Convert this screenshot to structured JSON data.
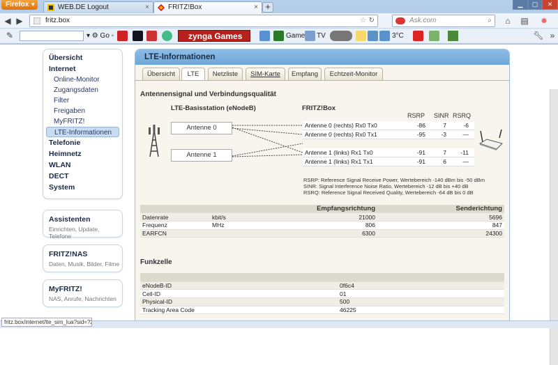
{
  "browser": {
    "menu_button": "Firefox",
    "tabs": [
      {
        "title": "WEB.DE Logout"
      },
      {
        "title": "FRITZ!Box"
      }
    ],
    "url": "fritz.box",
    "search_placeholder": "Ask.com",
    "toolbar": {
      "go_label": "Go",
      "zynga_label": "zynga Games",
      "games_label": "Games",
      "tv_label": "TV",
      "temp_label": "3°C"
    },
    "status_url": "fritz.box/internet/lte_sim_lua?sid=?2062dd466e8f60"
  },
  "sidebar": {
    "menu": [
      {
        "label": "Übersicht",
        "level": "main"
      },
      {
        "label": "Internet",
        "level": "main"
      },
      {
        "label": "Online-Monitor",
        "level": "sub"
      },
      {
        "label": "Zugangsdaten",
        "level": "sub"
      },
      {
        "label": "Filter",
        "level": "sub"
      },
      {
        "label": "Freigaben",
        "level": "sub"
      },
      {
        "label": "MyFRITZ!",
        "level": "sub"
      },
      {
        "label": "LTE-Informationen",
        "level": "sub",
        "selected": true
      },
      {
        "label": "Telefonie",
        "level": "main"
      },
      {
        "label": "Heimnetz",
        "level": "main"
      },
      {
        "label": "WLAN",
        "level": "main"
      },
      {
        "label": "DECT",
        "level": "main"
      },
      {
        "label": "System",
        "level": "main"
      }
    ],
    "boxes": [
      {
        "title": "Assistenten",
        "subtitle": "Einrichten, Update, Telefone"
      },
      {
        "title": "FRITZ!NAS",
        "subtitle": "Daten, Musik, Bilder, Filme"
      },
      {
        "title": "MyFRITZ!",
        "subtitle": "NAS, Anrufe, Nachrichten"
      }
    ]
  },
  "main": {
    "title": "LTE-Informationen",
    "tabs": [
      "Übersicht",
      "LTE",
      "Netzliste",
      "SIM-Karte",
      "Empfang",
      "Echtzeit-Monitor"
    ],
    "active_tab": "LTE",
    "signal": {
      "heading": "Antennensignal und Verbindungsqualität",
      "basestation_heading": "LTE-Basisstation (eNodeB)",
      "fritzbox_heading": "FRITZ!Box",
      "antenna_labels": [
        "Antenne 0",
        "Antenne 1"
      ],
      "columns": [
        "RSRP",
        "SINR",
        "RSRQ"
      ],
      "rows": [
        {
          "name": "Antenne 0 (rechts) Rx0 Tx0",
          "rsrp": "-86",
          "sinr": "7",
          "rsrq": "-6"
        },
        {
          "name": "Antenne 0 (rechts) Rx0 Tx1",
          "rsrp": "-95",
          "sinr": "-3",
          "rsrq": "—"
        },
        {
          "name": "Antenne 1 (links) Rx1 Tx0",
          "rsrp": "-91",
          "sinr": "7",
          "rsrq": "-11"
        },
        {
          "name": "Antenne 1 (links) Rx1 Tx1",
          "rsrp": "-91",
          "sinr": "6",
          "rsrq": "—"
        }
      ],
      "legend": [
        "RSRP: Reference Signal Receive Power, Wertebereich -140 dBm bis -50 dBm",
        "SINR: Signal Interference Noise Ratio, Wertebereich -12 dB bis +40 dB",
        "RSRQ: Reference Signal Received Quality, Wertebereich -64 dB bis 0 dB"
      ]
    },
    "rates": {
      "col_down": "Empfangsrichtung",
      "col_up": "Senderichtung",
      "rows": [
        {
          "name": "Datenrate",
          "unit": "kbit/s",
          "down": "21000",
          "up": "5696"
        },
        {
          "name": "Frequenz",
          "unit": "MHz",
          "down": "806",
          "up": "847"
        },
        {
          "name": "EARFCN",
          "unit": "",
          "down": "6300",
          "up": "24300"
        }
      ]
    },
    "cell": {
      "heading": "Funkzelle",
      "rows": [
        {
          "name": "eNodeB-ID",
          "value": "0f6c4"
        },
        {
          "name": "Cell-ID",
          "value": "01"
        },
        {
          "name": "Physical-ID",
          "value": "500"
        },
        {
          "name": "Tracking Area Code",
          "value": "46225"
        }
      ]
    }
  }
}
